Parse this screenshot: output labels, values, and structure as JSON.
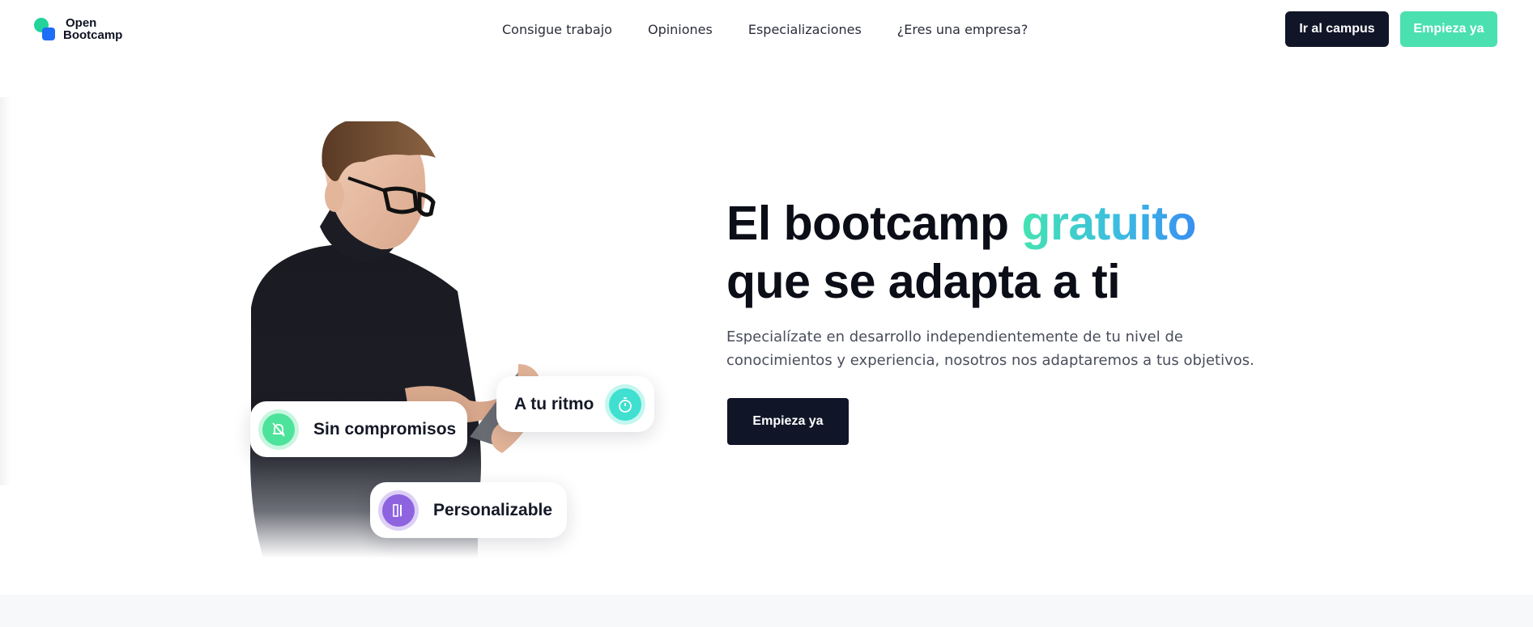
{
  "brand": {
    "line1": "Open",
    "line2": "Bootcamp",
    "colors": {
      "green": "#22d39a",
      "blue": "#1e6df6"
    }
  },
  "nav": {
    "items": [
      {
        "label": "Consigue trabajo"
      },
      {
        "label": "Opiniones"
      },
      {
        "label": "Especializaciones"
      },
      {
        "label": "¿Eres una empresa?"
      }
    ]
  },
  "header_actions": {
    "campus_label": "Ir al campus",
    "start_label": "Empieza ya"
  },
  "hero": {
    "title_part1": "El bootcamp ",
    "title_highlight": "gratuito",
    "title_line2": "que se adapta a ti",
    "subtitle_line1": "Especialízate en desarrollo independientemente de tu nivel de",
    "subtitle_line2": "conocimientos y experiencia, nosotros nos adaptaremos a tus objetivos.",
    "cta_label": "Empieza ya"
  },
  "features": [
    {
      "label": "Sin compromisos",
      "icon": "no-bell-icon",
      "color": "#4ee39a"
    },
    {
      "label": "A tu ritmo",
      "icon": "stopwatch-icon",
      "color": "#3fe0d0"
    },
    {
      "label": "Personalizable",
      "icon": "tools-icon",
      "color": "#8e63e0"
    }
  ],
  "colors": {
    "dark": "#111528",
    "accent_green": "#4be0b0",
    "text_muted": "#4a4e5c"
  }
}
